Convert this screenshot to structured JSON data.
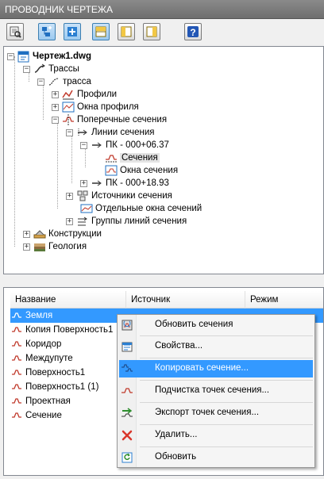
{
  "window": {
    "title": "ПРОВОДНИК ЧЕРТЕЖА"
  },
  "toolbar": {
    "buttons": [
      "find-icon",
      "tree-view-icon",
      "tree-view-alt-icon",
      "layout-horizontal-icon",
      "layout-vertical-icon",
      "layout-vertical-alt-icon",
      "help-icon"
    ]
  },
  "tree": {
    "root": "Чертеж1.dwg",
    "items": {
      "alignments": "Трассы",
      "alignment": "трасса",
      "profiles": "Профили",
      "profile_views": "Окна профиля",
      "sections": "Поперечные сечения",
      "sample_lines": "Линии сечения",
      "station1": "ПК - 000+06.37",
      "section_items": "Сечения",
      "section_views": "Окна сечения",
      "station2": "ПК - 000+18.93",
      "section_sources": "Источники сечения",
      "sep_views": "Отдельные окна сечений",
      "line_groups": "Группы линий сечения",
      "construction": "Конструкции",
      "geology": "Геология"
    }
  },
  "list": {
    "columns": [
      "Название",
      "Источник",
      "Режим"
    ],
    "rows": [
      {
        "name": "Земля",
        "source": "",
        "mode": ""
      },
      {
        "name": "Копия Поверхность1",
        "source": "",
        "mode": ""
      },
      {
        "name": "Коридор",
        "source": "",
        "mode": ""
      },
      {
        "name": "Междупуте",
        "source": "",
        "mode": ""
      },
      {
        "name": "Поверхность1",
        "source": "",
        "mode": ""
      },
      {
        "name": "Поверхность1 (1)",
        "source": "",
        "mode": ""
      },
      {
        "name": "Проектная",
        "source": "",
        "mode": ""
      },
      {
        "name": "Сечение",
        "source": "",
        "mode": ""
      }
    ]
  },
  "context_menu": {
    "items": [
      {
        "label": "Обновить сечения",
        "icon": "update-sections-icon"
      },
      {
        "label": "Свойства...",
        "icon": "properties-icon"
      },
      {
        "label": "Копировать сечение...",
        "icon": "copy-section-icon"
      },
      {
        "label": "Подчистка точек сечения...",
        "icon": "section-cleanup-icon"
      },
      {
        "label": "Экспорт точек сечения...",
        "icon": "export-points-icon"
      },
      {
        "label": "Удалить...",
        "icon": "delete-icon"
      },
      {
        "label": "Обновить",
        "icon": "refresh-icon"
      }
    ]
  },
  "colors": {
    "selection": "#3399ff",
    "titlebar": "#7c7c7c",
    "panel_border": "#828790"
  }
}
